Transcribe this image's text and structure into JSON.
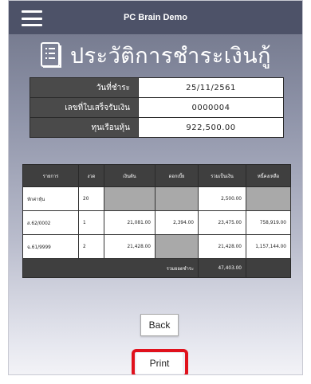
{
  "header": {
    "title": "PC Brain Demo",
    "menu_icon": "hamburger-menu-icon"
  },
  "page": {
    "title": "ประวัติการชำระเงินกู้",
    "title_icon": "document-list-icon"
  },
  "info": [
    {
      "label": "วันที่ชำระ",
      "value": "25/11/2561"
    },
    {
      "label": "เลขที่ใบเสร็จรับเงิน",
      "value": "0000004"
    },
    {
      "label": "ทุนเรือนหุ้น",
      "value": "922,500.00"
    }
  ],
  "table": {
    "columns": [
      "รายการ",
      "งวด",
      "เงินต้น",
      "ดอกเบี้ย",
      "รวมเป็นเงิน",
      "หนี้คงเหลือ"
    ],
    "rows": [
      {
        "item": "หักค่าหุ้น",
        "period": "20",
        "principal": "",
        "interest": "",
        "total": "2,500.00",
        "balance": ""
      },
      {
        "item": "ส.62/0002",
        "period": "1",
        "principal": "21,081.00",
        "interest": "2,394.00",
        "total": "23,475.00",
        "balance": "758,919.00"
      },
      {
        "item": "ฉ.61/9999",
        "period": "2",
        "principal": "21,428.00",
        "interest": "",
        "total": "21,428.00",
        "balance": "1,157,144.00"
      }
    ],
    "total_label": "รวมยอดชำระ",
    "total_value": "47,403.00"
  },
  "buttons": {
    "back_label": "Back",
    "print_label": "Print"
  },
  "colors": {
    "header_bg": "#4d5268",
    "highlight": "#e0111c",
    "table_header": "#3f3f3f"
  }
}
